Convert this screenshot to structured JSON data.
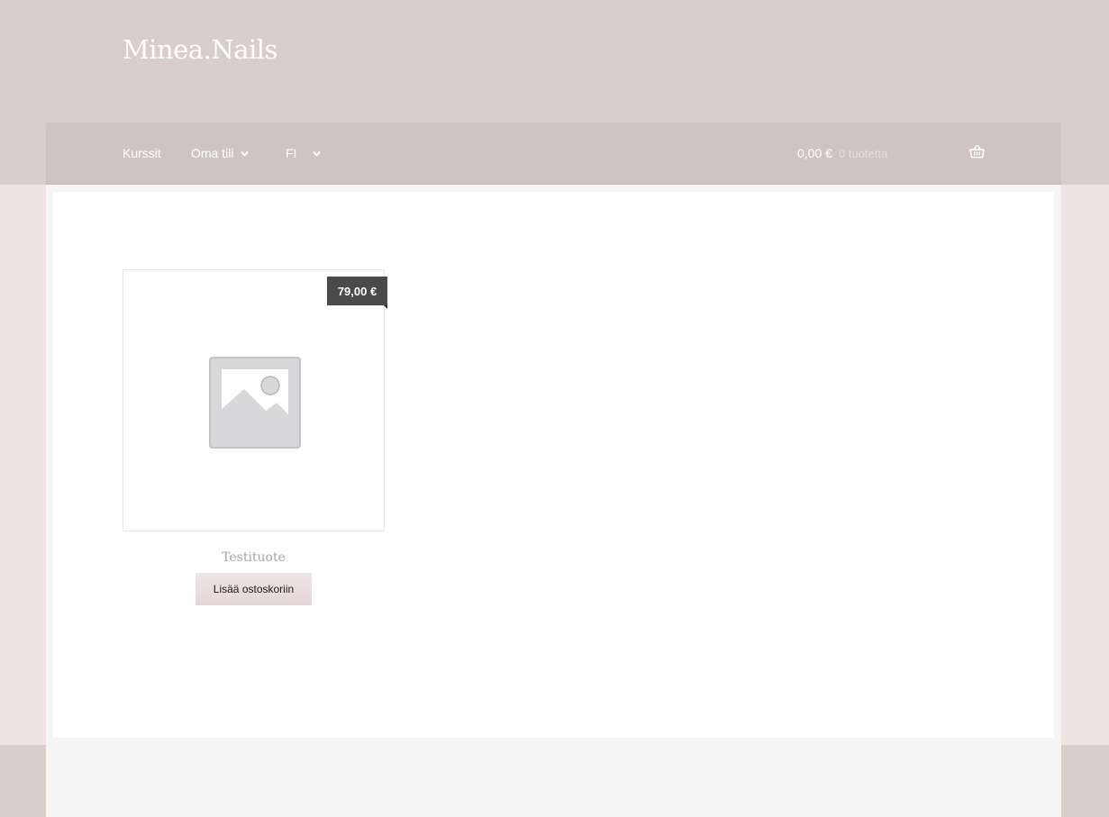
{
  "site": {
    "title": "Minea.Nails"
  },
  "nav": {
    "items": [
      {
        "label": "Kurssit",
        "has_dropdown": false,
        "active": true
      },
      {
        "label": "Oma tili",
        "has_dropdown": true
      },
      {
        "label": "FI",
        "has_dropdown": true
      }
    ]
  },
  "cart": {
    "total": "0,00 €",
    "count_text": "0 tuotetta",
    "icon": "basket-icon"
  },
  "products": [
    {
      "title": "Testituote",
      "price": "79,00 €",
      "image": "placeholder-image-icon",
      "button_label": "Lisää ostoskoriin"
    }
  ],
  "colors": {
    "header_bg": "#d9cfca",
    "nav_bg": "#cfc5c0",
    "page_bg": "#efe3e4",
    "price_badge": "#4a4a4a",
    "button_bg": "#e9dcde"
  }
}
